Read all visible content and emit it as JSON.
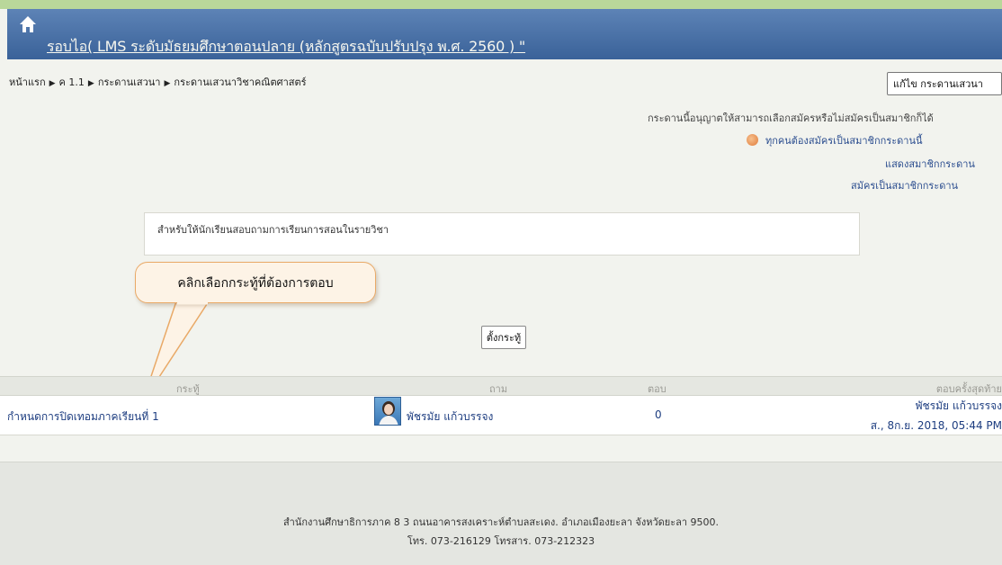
{
  "header": {
    "title": "รอบไอ( LMS ระดับมัธยมศึกษาตอนปลาย (หลักสูตรฉบับปรับปรุง พ.ศ. 2560 ) \""
  },
  "breadcrumb": {
    "items": [
      "หน้าแรก",
      "ค 1.1",
      "กระดานเสวนา",
      "กระดานเสวนาวิชาคณิตศาสตร์"
    ]
  },
  "toolbar": {
    "edit_forum_label": "แก้ไข กระดานเสวนา"
  },
  "subscription": {
    "notice": "กระดานนี้อนุญาตให้สามารถเลือกสมัครหรือไม่สมัครเป็นสมาชิกก็ได้",
    "forced": "ทุกคนต้องสมัครเป็นสมาชิกกระดานนี้",
    "show_members": "แสดงสมาชิกกระดาน",
    "subscribe": "สมัครเป็นสมาชิกกระดาน"
  },
  "intro": {
    "text": "สำหรับให้นักเรียนสอบถามการเรียนการสอนในรายวิชา"
  },
  "callout": {
    "text": "คลิกเลือกกระทู้ที่ต้องการตอบ"
  },
  "new_discussion": {
    "label": "ตั้งกระทู้"
  },
  "table": {
    "headers": {
      "topic": "กระทู้",
      "author": "ถาม",
      "replies": "ตอบ",
      "last_post": "ตอบครั้งสุดท้าย"
    },
    "rows": [
      {
        "topic": "กำหนดการปิดเทอมภาคเรียนที่ 1",
        "author": "พัชรมัย แก้วบรรจง",
        "replies": "0",
        "last_author": "พัชรมัย แก้วบรรจง",
        "last_date": "ส., 8ก.ย. 2018, 05:44 PM"
      }
    ]
  },
  "footer": {
    "line1": "สำนักงานศึกษาธิการภาค 8 3 ถนนอาคารสงเคราะห์ตำบลสะเดง. อำเภอเมืองยะลา จังหวัดยะลา 9500.",
    "line2": "โทร. 073-216129 โทรสาร. 073-212323"
  },
  "colors": {
    "header_bg": "#4a72a8",
    "link": "#1d3d80",
    "callout_border": "#e9a967"
  },
  "icons": {
    "home": "home-icon",
    "warning": "warning-circle-icon"
  }
}
